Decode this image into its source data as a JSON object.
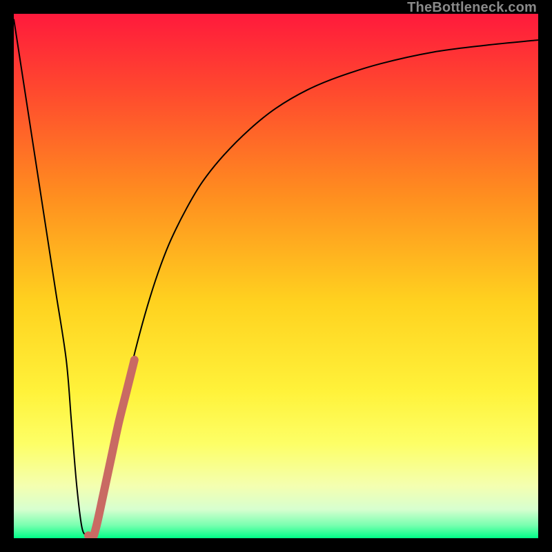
{
  "watermark": "TheBottleneck.com",
  "colors": {
    "gradient_stops": [
      {
        "offset": 0.0,
        "color": "#ff1a3c"
      },
      {
        "offset": 0.15,
        "color": "#ff4a2e"
      },
      {
        "offset": 0.35,
        "color": "#ff8f1f"
      },
      {
        "offset": 0.55,
        "color": "#ffd21f"
      },
      {
        "offset": 0.72,
        "color": "#fff23a"
      },
      {
        "offset": 0.82,
        "color": "#fdff66"
      },
      {
        "offset": 0.9,
        "color": "#f4ffb0"
      },
      {
        "offset": 0.945,
        "color": "#d7ffcf"
      },
      {
        "offset": 0.975,
        "color": "#7affb0"
      },
      {
        "offset": 1.0,
        "color": "#00ff88"
      }
    ],
    "curve": "#000000",
    "highlight": "#c96a63"
  },
  "chart_data": {
    "type": "line",
    "title": "",
    "xlabel": "",
    "ylabel": "",
    "xlim": [
      0,
      100
    ],
    "ylim": [
      0,
      100
    ],
    "grid": false,
    "legend": false,
    "annotations": [],
    "series": [
      {
        "name": "curve",
        "x": [
          0,
          2,
          4,
          6,
          8,
          10,
          11,
          12,
          13,
          14,
          15,
          16,
          18,
          20,
          22,
          24,
          26,
          28,
          30,
          33,
          36,
          40,
          45,
          50,
          56,
          62,
          70,
          80,
          90,
          100
        ],
        "y": [
          99,
          86,
          73,
          60,
          47,
          34,
          22,
          10,
          2,
          0.5,
          0,
          3,
          12,
          22,
          31,
          39,
          46,
          52,
          57,
          63,
          68,
          73,
          78,
          82,
          85.5,
          88,
          90.5,
          92.7,
          94,
          95
        ]
      },
      {
        "name": "highlight",
        "x": [
          14.2,
          15.0,
          15.8,
          17.0,
          18.5,
          20.0,
          21.5,
          23.0
        ],
        "y": [
          0.5,
          0.0,
          2.5,
          8.0,
          15.0,
          22.0,
          28.0,
          34.0
        ]
      }
    ]
  }
}
